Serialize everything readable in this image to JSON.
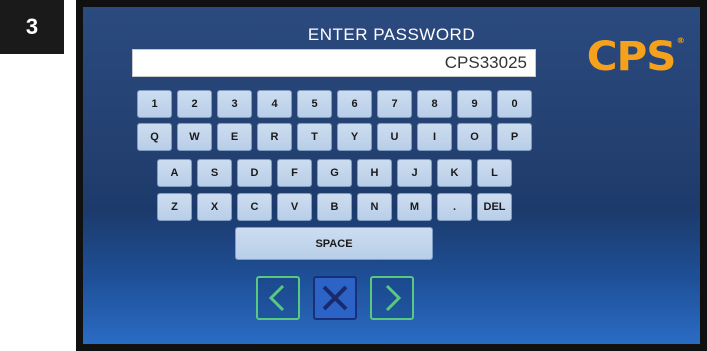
{
  "step_badge": "3",
  "header": {
    "title": "ENTER PASSWORD"
  },
  "password_field": {
    "value": "CPS33025"
  },
  "logo": {
    "text": "CPS",
    "trademark": "®"
  },
  "keyboard": {
    "row1": [
      "1",
      "2",
      "3",
      "4",
      "5",
      "6",
      "7",
      "8",
      "9",
      "0"
    ],
    "row2": [
      "Q",
      "W",
      "E",
      "R",
      "T",
      "Y",
      "U",
      "I",
      "O",
      "P"
    ],
    "row3": [
      "A",
      "S",
      "D",
      "F",
      "G",
      "H",
      "J",
      "K",
      "L"
    ],
    "row4": [
      "Z",
      "X",
      "C",
      "V",
      "B",
      "N",
      "M",
      ".",
      "DEL"
    ],
    "space": "SPACE"
  },
  "nav": {
    "back_icon": "chevron-left-icon",
    "cancel_icon": "x-icon",
    "next_icon": "chevron-right-icon",
    "colors": {
      "back_next_border": "#58c97f",
      "cancel_fill": "#2b64c6",
      "accent_logo": "#f5a11b"
    }
  }
}
